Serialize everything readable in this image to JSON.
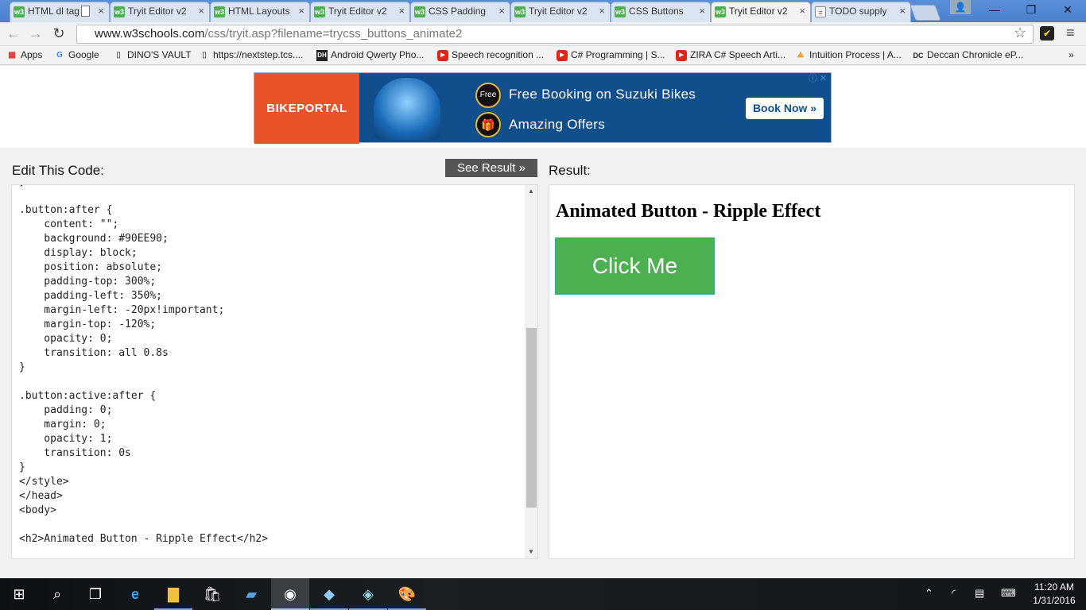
{
  "browser": {
    "tabs": [
      {
        "label": "HTML dl tag",
        "icon": "w3schools-icon"
      },
      {
        "label": "Tryit Editor v2",
        "icon": "w3schools-icon"
      },
      {
        "label": "HTML Layouts",
        "icon": "w3schools-icon"
      },
      {
        "label": "Tryit Editor v2",
        "icon": "w3schools-icon"
      },
      {
        "label": "CSS Padding",
        "icon": "w3schools-icon"
      },
      {
        "label": "Tryit Editor v2",
        "icon": "w3schools-icon"
      },
      {
        "label": "CSS Buttons",
        "icon": "w3schools-icon"
      },
      {
        "label": "Tryit Editor v2",
        "icon": "w3schools-icon",
        "active": true
      },
      {
        "label": "TODO supply",
        "icon": "document-icon"
      }
    ],
    "url_host": "www.w3schools.com",
    "url_path": "/css/tryit.asp?filename=trycss_buttons_animate2",
    "bookmarks": [
      {
        "label": "Apps",
        "icon": "apps-grid-icon"
      },
      {
        "label": "Google",
        "icon": "google-icon"
      },
      {
        "label": "DINO'S VAULT",
        "icon": "page-icon"
      },
      {
        "label": "https://nextstep.tcs....",
        "icon": "page-icon"
      },
      {
        "label": "Android Qwerty Pho...",
        "icon": "dh-icon"
      },
      {
        "label": "Speech recognition ...",
        "icon": "youtube-icon"
      },
      {
        "label": "C# Programming | S...",
        "icon": "youtube-icon"
      },
      {
        "label": "ZIRA C# Speech Arti...",
        "icon": "youtube-icon"
      },
      {
        "label": "Intuition Process | A...",
        "icon": "landscape-icon"
      },
      {
        "label": "Deccan Chronicle eP...",
        "icon": "dc-icon"
      }
    ],
    "overflow_glyph": "»"
  },
  "ad": {
    "brand": "BIKEPORTAL",
    "badge_free": "Free",
    "line1": "Free Booking on Suzuki Bikes",
    "line2": "Amazing Offers",
    "cta": "Book Now »"
  },
  "editor": {
    "edit_label": "Edit This Code:",
    "see_result": "See Result »",
    "result_label": "Result:",
    "code": "}\n\n.button:after {\n    content: \"\";\n    background: #90EE90;\n    display: block;\n    position: absolute;\n    padding-top: 300%;\n    padding-left: 350%;\n    margin-left: -20px!important;\n    margin-top: -120%;\n    opacity: 0;\n    transition: all 0.8s\n}\n\n.button:active:after {\n    padding: 0;\n    margin: 0;\n    opacity: 1;\n    transition: 0s\n}\n</style>\n</head>\n<body>\n\n<h2>Animated Button - Ripple Effect</h2>"
  },
  "result": {
    "heading": "Animated Button - Ripple Effect",
    "button_label": "Click Me",
    "button_color": "#4CAF50"
  },
  "taskbar": {
    "time": "11:20 AM",
    "date": "1/31/2016"
  }
}
